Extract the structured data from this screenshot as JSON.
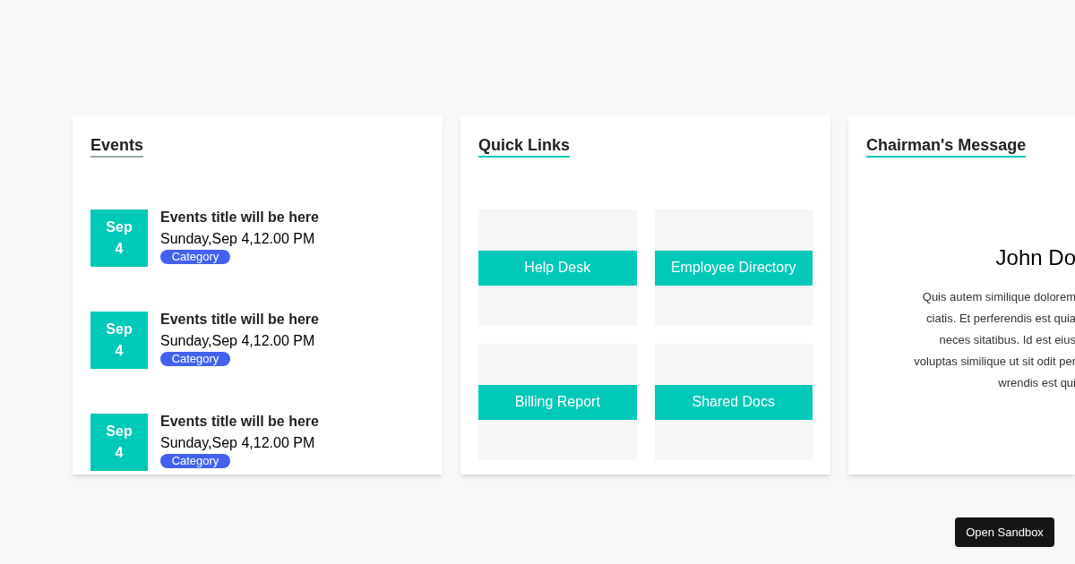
{
  "events": {
    "title": "Events",
    "items": [
      {
        "month": "Sep",
        "day": "4",
        "title": "Events title will be here",
        "when": "Sunday,Sep 4,12.00 PM",
        "category": "Category"
      },
      {
        "month": "Sep",
        "day": "4",
        "title": "Events title will be here",
        "when": "Sunday,Sep 4,12.00 PM",
        "category": "Category"
      },
      {
        "month": "Sep",
        "day": "4",
        "title": "Events title will be here",
        "when": "Sunday,Sep 4,12.00 PM",
        "category": "Category"
      }
    ]
  },
  "quick_links": {
    "title": "Quick Links",
    "links": [
      "Help Desk",
      "Employee Directory",
      "Billing Report",
      "Shared Docs"
    ]
  },
  "chairman": {
    "title": "Chairman's Message",
    "name": "John Do",
    "message_lines": [
      "Quis autem similique dolorem",
      "ciatis. Et perferendis est quia",
      "neces sitatibus. Id est eius",
      "voluptas similique ut sit odit per",
      "wrendis est qui"
    ]
  },
  "sandbox_button": "Open Sandbox"
}
